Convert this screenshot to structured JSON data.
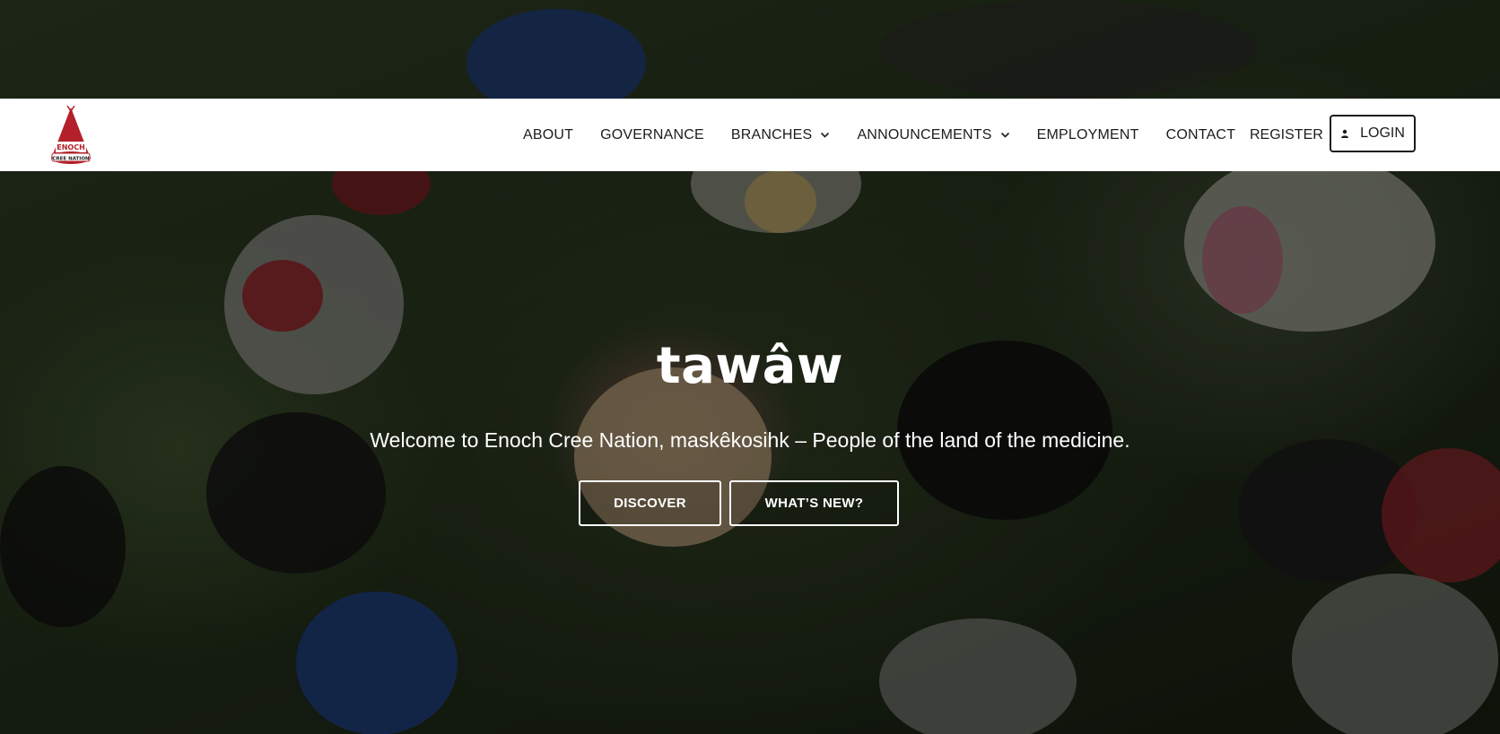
{
  "header": {
    "logo_text_top": "ENOCH",
    "logo_text_bottom": "CREE NATION",
    "nav": [
      {
        "label": "ABOUT",
        "has_dropdown": false
      },
      {
        "label": "GOVERNANCE",
        "has_dropdown": false
      },
      {
        "label": "BRANCHES",
        "has_dropdown": true
      },
      {
        "label": "ANNOUNCEMENTS",
        "has_dropdown": true
      },
      {
        "label": "EMPLOYMENT",
        "has_dropdown": false
      },
      {
        "label": "CONTACT",
        "has_dropdown": false
      }
    ],
    "register_label": "REGISTER",
    "login_label": "LOGIN"
  },
  "hero": {
    "title": "tawâw",
    "subtitle": "Welcome to Enoch Cree Nation, maskêkosihk – People of the land of the medicine.",
    "buttons": {
      "discover": "DISCOVER",
      "whats_new": "WHAT’S NEW?"
    }
  },
  "icons": {
    "logo": "teepee-logo-icon",
    "dropdown": "chevron-down-icon",
    "login": "user-icon"
  },
  "colors": {
    "logo_red": "#b3202a",
    "header_bg": "#ffffff",
    "nav_text": "#1c1c1c",
    "hero_text": "#ffffff"
  }
}
